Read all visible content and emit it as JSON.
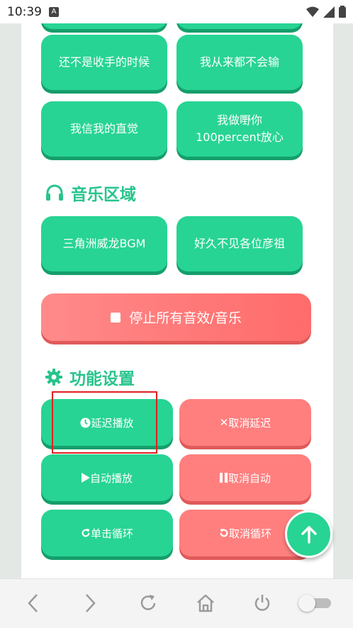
{
  "status_bar": {
    "time": "10:39",
    "notification_icon": "a-letter-icon"
  },
  "upper_buttons": [
    {
      "label": "还不是收手的时候"
    },
    {
      "label": "我从来都不会输"
    },
    {
      "label": "我信我的直觉"
    },
    {
      "label": "我做嘢你\n100percent放心"
    }
  ],
  "music_section": {
    "title": "音乐区域",
    "icon": "headphones-icon",
    "buttons": [
      {
        "label": "三角洲威龙BGM"
      },
      {
        "label": "好久不见各位彦祖"
      }
    ],
    "stop_label": "停止所有音效/音乐"
  },
  "settings_section": {
    "title": "功能设置",
    "icon": "gear-icon",
    "delay_play": "延迟播放",
    "cancel_delay": "取消延迟",
    "auto_play": "自动播放",
    "cancel_auto": "取消自动",
    "single_loop": "单击循环",
    "cancel_loop": "取消循环"
  },
  "colors": {
    "green": "#27d494",
    "red": "#ff7f7f",
    "title_green": "#27c48c"
  }
}
